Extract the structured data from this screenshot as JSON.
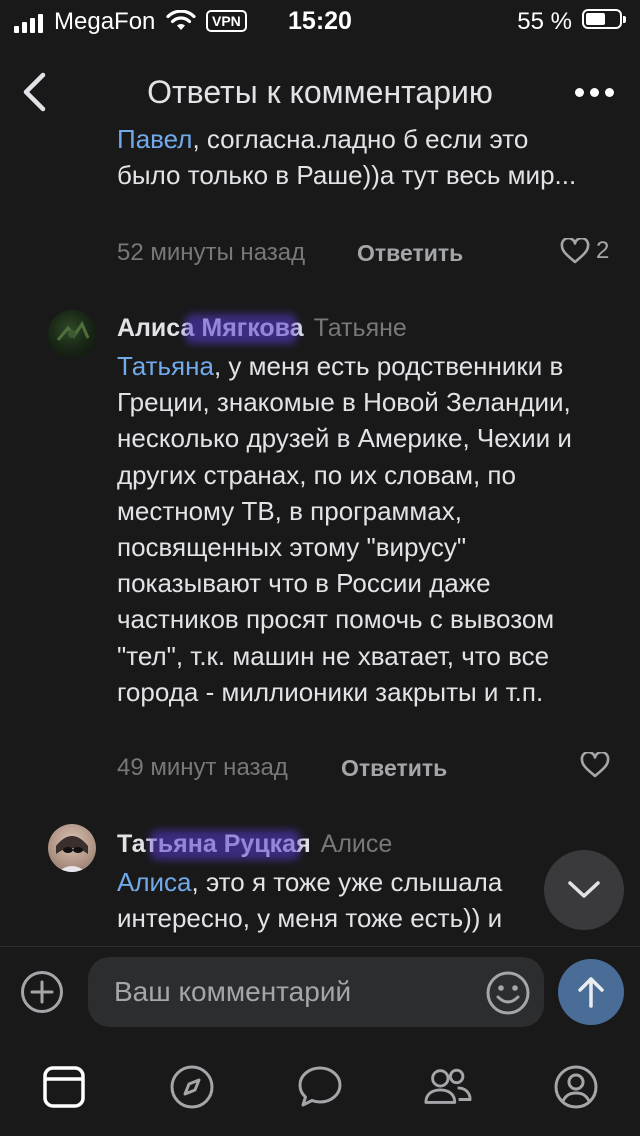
{
  "status_bar": {
    "carrier": "MegaFon",
    "vpn": "VPN",
    "time": "15:20",
    "battery_percent": "55 %"
  },
  "header": {
    "title": "Ответы к комментарию"
  },
  "comments": [
    {
      "text_mention": "Павел",
      "text_body": ", согласна.ладно б если это было только в Раше))а тут весь мир...",
      "time": "52 минуты назад",
      "reply_label": "Ответить",
      "like_count": "2"
    },
    {
      "author": "Алиса Мягкова",
      "reply_to": "Татьяне",
      "text_mention": "Татьяна",
      "text_body": ", у меня есть родственники в Греции, знакомые в Новой Зеландии, несколько друзей в Америке, Чехии и других странах, по их словам, по местному ТВ, в программах, посвященных этому \"вирусу\" показывают что в России даже частников просят помочь с вывозом \"тел\", т.к. машин не хватает, что все города - миллионики закрыты и т.п.",
      "time": "49 минут назад",
      "reply_label": "Ответить"
    },
    {
      "author": "Татьяна Руцкая",
      "reply_to": "Алисе",
      "text_mention": "Алиса",
      "text_body": ", это я тоже уже слышала интересно, у меня тоже есть)) и"
    }
  ],
  "composer": {
    "placeholder": "Ваш комментарий"
  },
  "tab_bar": {
    "items": [
      "news-icon",
      "discover-icon",
      "messages-icon",
      "friends-icon",
      "profile-icon"
    ]
  },
  "colors": {
    "background": "#19191a",
    "text": "#e1e3e6",
    "secondary": "#76787a",
    "mention": "#71aaeb",
    "send_button": "#4a6d98"
  }
}
